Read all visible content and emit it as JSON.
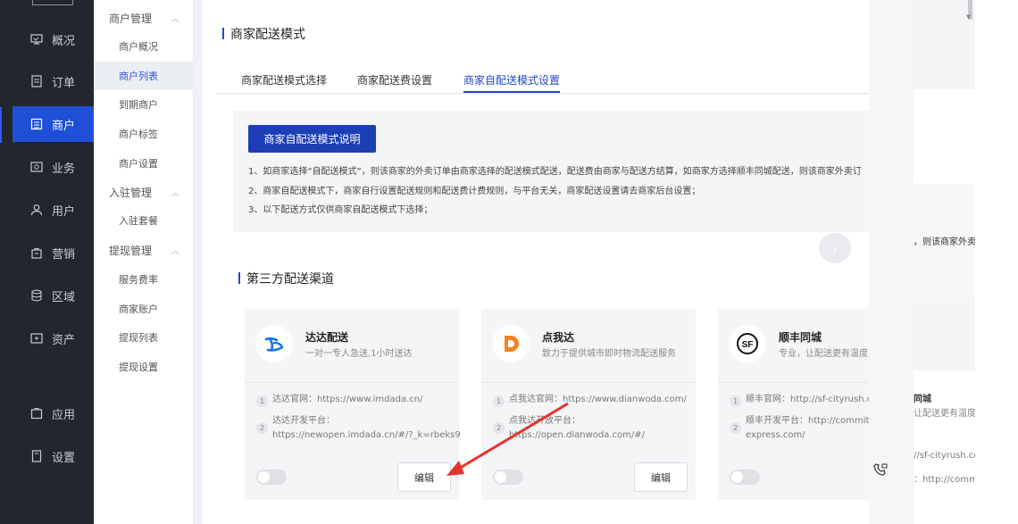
{
  "nav": {
    "items": [
      {
        "label": "概况",
        "icon": "monitor-icon"
      },
      {
        "label": "订单",
        "icon": "order-list-icon"
      },
      {
        "label": "商户",
        "icon": "store-icon"
      },
      {
        "label": "业务",
        "icon": "business-icon"
      },
      {
        "label": "用户",
        "icon": "user-icon"
      },
      {
        "label": "营销",
        "icon": "marketing-bag-icon"
      },
      {
        "label": "区域",
        "icon": "database-icon"
      },
      {
        "label": "资产",
        "icon": "asset-icon"
      },
      {
        "label": "应用",
        "icon": "app-icon"
      },
      {
        "label": "设置",
        "icon": "settings-doc-icon"
      }
    ],
    "active": "商户"
  },
  "subnav": {
    "groups": [
      {
        "label": "商户管理",
        "items": [
          "商户概况",
          "商户列表",
          "到期商户",
          "商户标签",
          "商户设置"
        ]
      },
      {
        "label": "入驻管理",
        "items": [
          "入驻套餐"
        ]
      },
      {
        "label": "提现管理",
        "items": [
          "服务费率",
          "商家账户",
          "提现列表",
          "提现设置"
        ]
      }
    ],
    "active": "商户列表"
  },
  "page": {
    "title": "商家配送模式",
    "tabs": [
      "商家配送模式选择",
      "商家配送费设置",
      "商家自配送模式设置"
    ],
    "active_tab": "商家自配送模式设置"
  },
  "info": {
    "button": "商家自配送模式说明",
    "lines": [
      "1、如商家选择“自配送模式”，则该商家的外卖订单由商家选择的配送模式配送，配送费由商家与配送方结算，如商家方选择顺丰同城配送，则该商家外卖订",
      "2、商家自配送模式下，商家自行设置配送规则和配送费计费规则，与平台无关，商家配送设置请去商家后台设置；",
      "3、以下配送方式仅供商家自配送模式下选择；"
    ]
  },
  "section": {
    "title": "第三方配送渠道"
  },
  "cards": [
    {
      "name": "达达配送",
      "desc": "一对一专人急送,1小时送达",
      "logo": "dada-logo-icon",
      "line1": "达达官网：https://www.imdada.cn/",
      "line2a": "达达开发平台：",
      "line2b": "https://newopen.imdada.cn/#/?_k=rbeks9",
      "edit": "编辑",
      "enabled": false
    },
    {
      "name": "点我达",
      "desc": "致力于提供城市即时物流配送服务",
      "logo": "dianwoda-logo-icon",
      "line1": "点我达官网：https://www.dianwoda.com/",
      "line2a": "点我达开放平台：",
      "line2b": "https://open.dianwoda.com/#/",
      "edit": "编辑",
      "enabled": false
    },
    {
      "name": "顺丰同城",
      "desc": "专业，让配送更有温度",
      "logo": "sf-logo-icon",
      "line1": "顺丰官网：http://sf-cityrush.com",
      "line2a": "顺丰开发平台：http://commit-d",
      "line2b": "express.com/",
      "edit": "",
      "enabled": false
    }
  ],
  "right": {
    "t1": "，则该商家外卖订",
    "t2": "同城",
    "t3": "让配送更有温度",
    "t4": "//sf-cityrush.com",
    "t5": "：http://commit-d"
  },
  "colors": {
    "primary": "#1c3fb6",
    "nav_bg": "#22262e",
    "nav_active": "#1f4fd6",
    "annotation_arrow": "#e8322c"
  }
}
